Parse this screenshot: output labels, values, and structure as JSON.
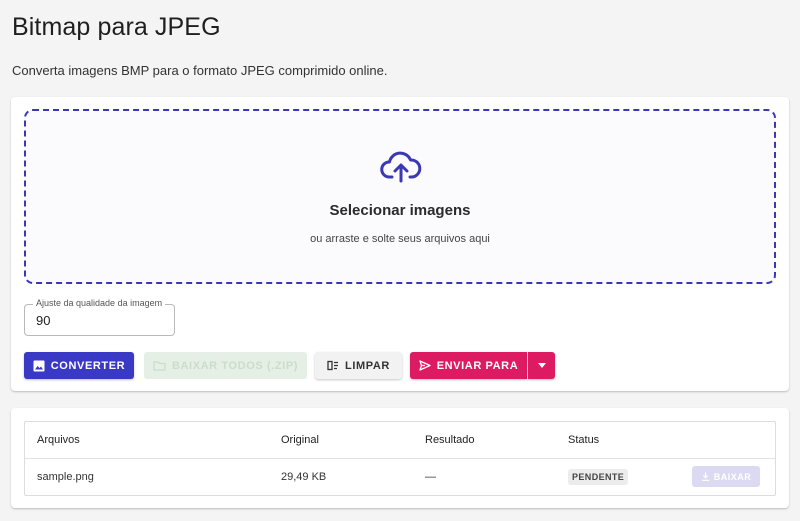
{
  "header": {
    "title": "Bitmap para JPEG",
    "subtitle": "Converta imagens BMP para o formato JPEG comprimido online."
  },
  "dropzone": {
    "title": "Selecionar imagens",
    "hint": "ou arraste e solte seus arquivos aqui",
    "icon": "cloud-upload-icon"
  },
  "quality": {
    "label": "Ajuste da qualidade da imagem",
    "value": "90"
  },
  "actions": {
    "convert_label": "Converter",
    "zip_label": "Baixar todos (.zip)",
    "clear_label": "Limpar",
    "send_label": "Enviar para"
  },
  "table": {
    "headers": [
      "Arquivos",
      "Original",
      "Resultado",
      "Status"
    ],
    "rows": [
      {
        "file": "sample.png",
        "original": "29,49 KB",
        "result": "—",
        "status": "PENDENTE",
        "download_label": "Baixar"
      }
    ]
  },
  "colors": {
    "primary": "#3a39c6",
    "accent": "#dd1b63",
    "dropzone_border": "#3a39b3"
  }
}
